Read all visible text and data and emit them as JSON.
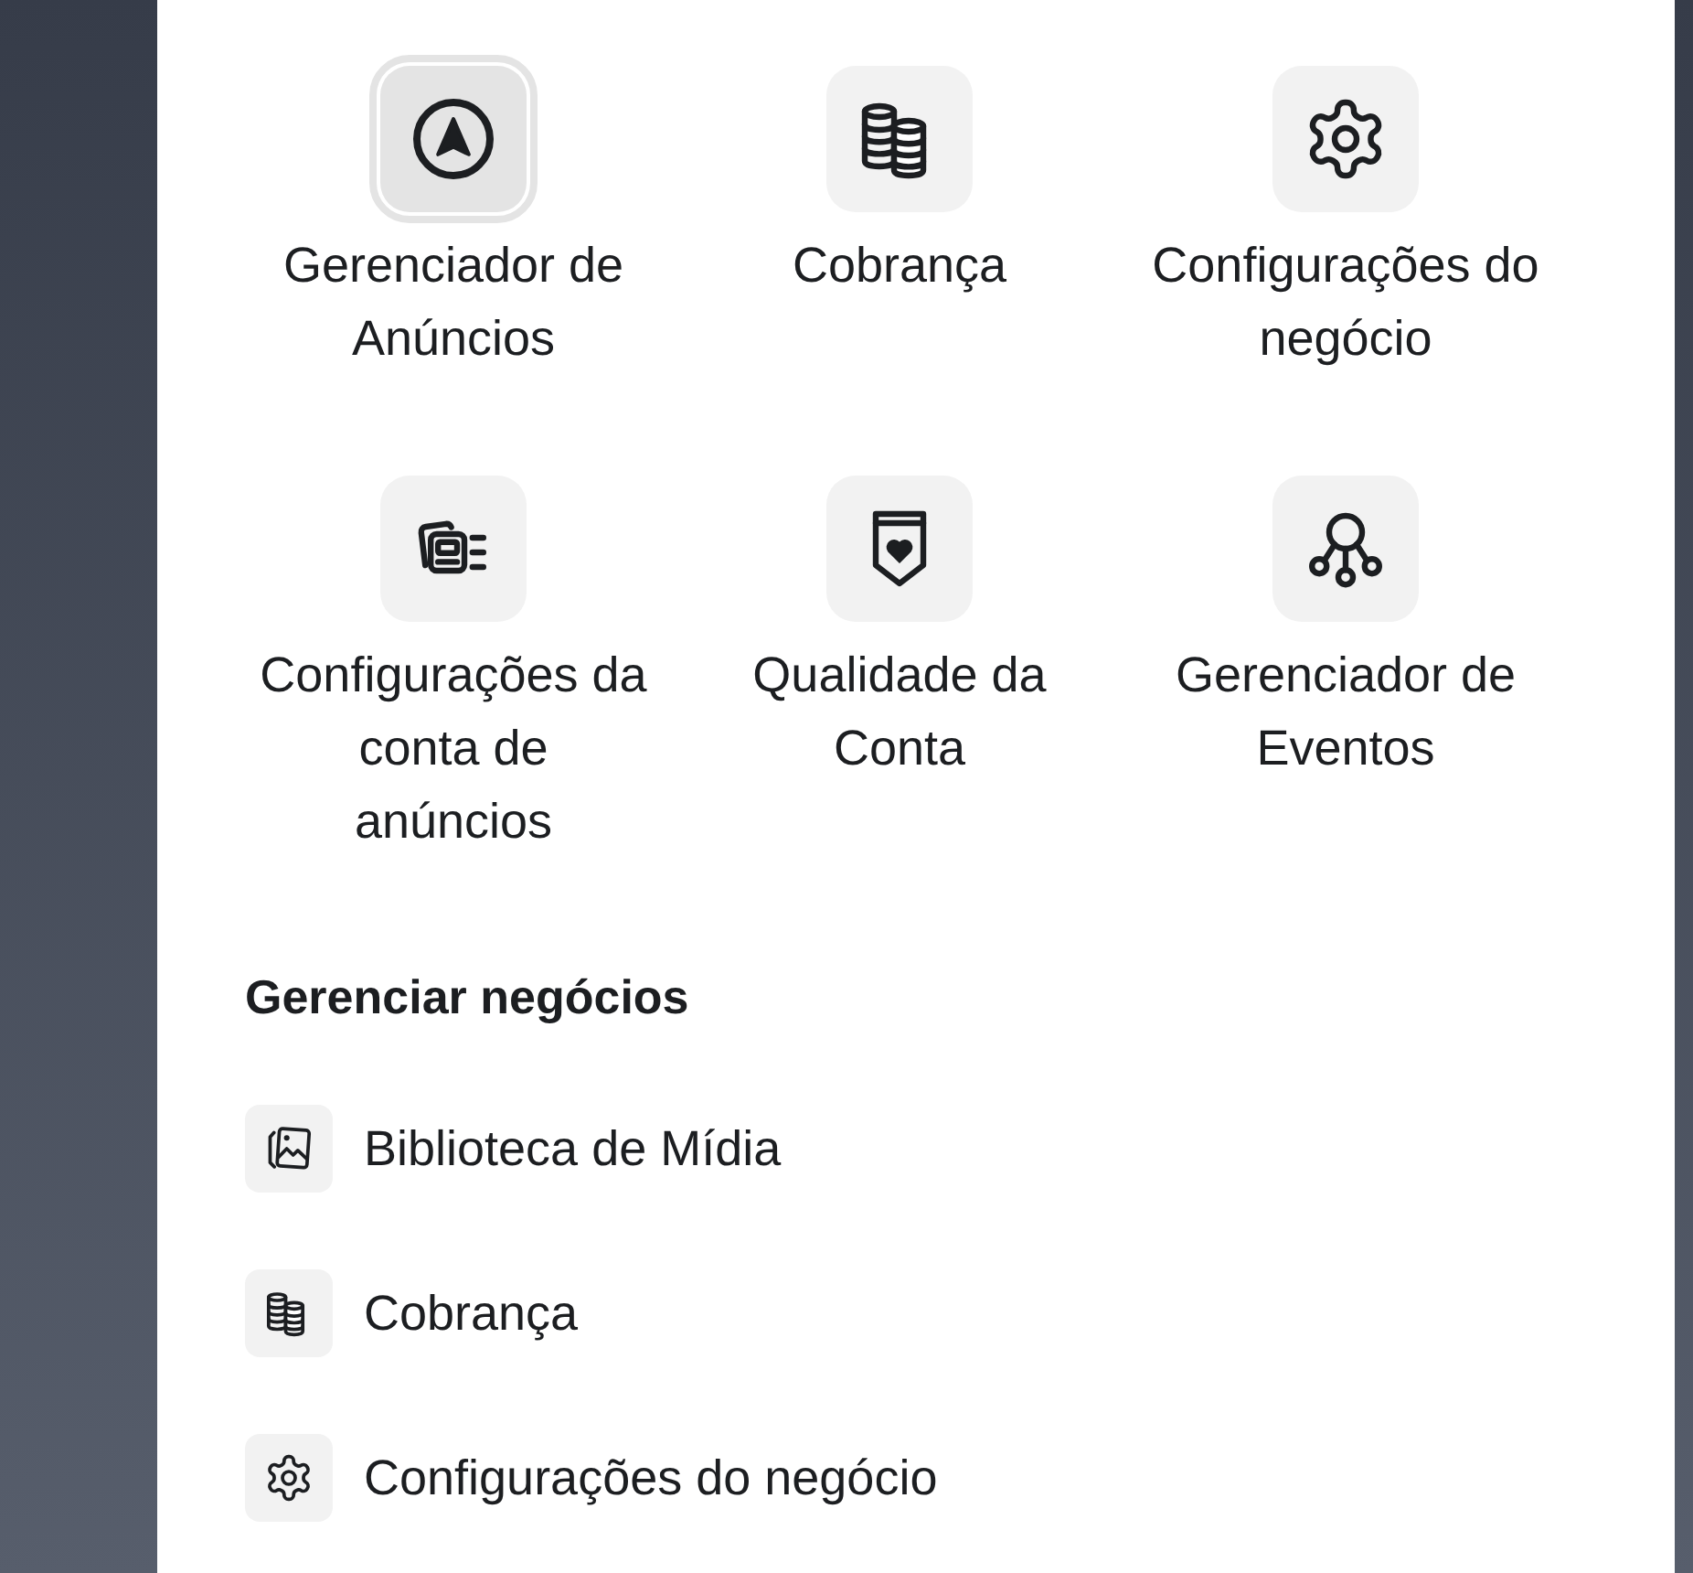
{
  "shortcuts": {
    "items": [
      {
        "label": "Gerenciador de Anúncios",
        "selected": true
      },
      {
        "label": "Cobrança",
        "selected": false
      },
      {
        "label": "Configurações do negócio",
        "selected": false
      },
      {
        "label": "Configurações da conta de anúncios",
        "selected": false
      },
      {
        "label": "Qualidade da Conta",
        "selected": false
      },
      {
        "label": "Gerenciador de Eventos",
        "selected": false
      }
    ]
  },
  "manage_business": {
    "title": "Gerenciar negócios",
    "items": [
      {
        "label": "Biblioteca de Mídia"
      },
      {
        "label": "Cobrança"
      },
      {
        "label": "Configurações do negócio"
      }
    ]
  }
}
